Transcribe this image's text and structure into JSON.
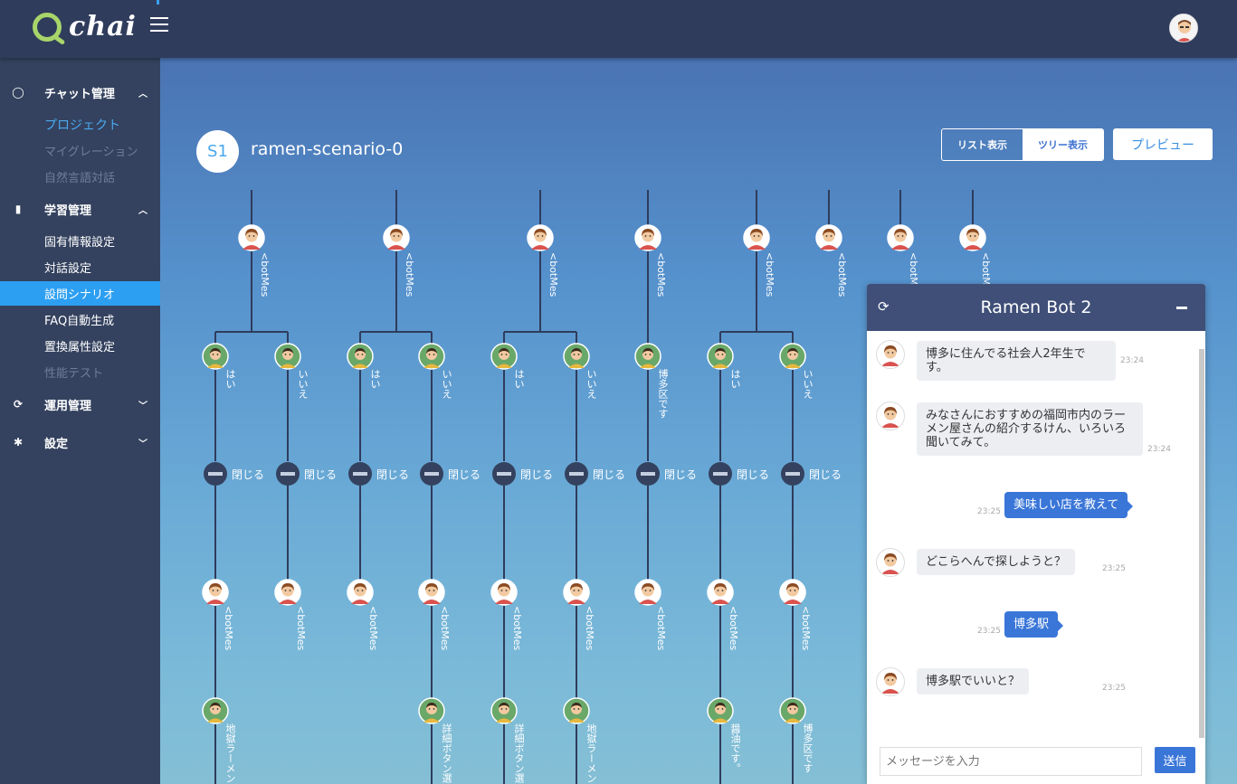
{
  "app": {
    "logo_text": "chai"
  },
  "sidebar": {
    "sections": [
      {
        "label": "チャット管理",
        "icon": "chat-bubble-icon",
        "expanded": true
      },
      {
        "label": "学習管理",
        "icon": "bookmark-icon",
        "expanded": true
      },
      {
        "label": "運用管理",
        "icon": "refresh-icon",
        "expanded": false
      },
      {
        "label": "設定",
        "icon": "gear-icon",
        "expanded": false
      }
    ],
    "chat_items": [
      "プロジェクト",
      "マイグレーション",
      "自然言語対話"
    ],
    "learn_items": [
      "固有情報設定",
      "対話設定",
      "設問シナリオ",
      "FAQ自動生成",
      "置換属性設定",
      "性能テスト"
    ]
  },
  "main": {
    "badge": "S1",
    "scenario_title": "ramen-scenario-0",
    "view_list": "リスト表示",
    "view_tree": "ツリー表示",
    "preview": "プレビュー"
  },
  "tree": {
    "top_label": "<botMes",
    "answers": [
      "はい",
      "いいえ",
      "はい",
      "いいえ",
      "はい",
      "いいえ",
      "博多区です",
      "はい",
      "いいえ"
    ],
    "close_label": "閉じる",
    "bottom_labels": [
      "地獄ラーメン",
      "",
      "",
      "詳細ボタン選",
      "詳細ボタン選",
      "地獄ラーメン",
      "",
      "醤油です。",
      "博多区です"
    ]
  },
  "chat": {
    "title": "Ramen Bot 2",
    "messages": [
      {
        "from": "bot",
        "text": "博多に住んでる社会人2年生です。",
        "time": "23:24"
      },
      {
        "from": "bot",
        "text": "みなさんにおすすめの福岡市内のラーメン屋さんの紹介するけん、いろいろ聞いてみて。",
        "time": "23:24"
      },
      {
        "from": "user",
        "text": "美味しい店を教えて",
        "time": "23:25"
      },
      {
        "from": "bot",
        "text": "どこらへんで探しようと？",
        "time": "23:25"
      },
      {
        "from": "user",
        "text": "博多駅",
        "time": "23:25"
      },
      {
        "from": "bot",
        "text": "博多駅でいいと？",
        "time": "23:25"
      }
    ],
    "input_placeholder": "メッセージを入力",
    "send": "送信"
  }
}
